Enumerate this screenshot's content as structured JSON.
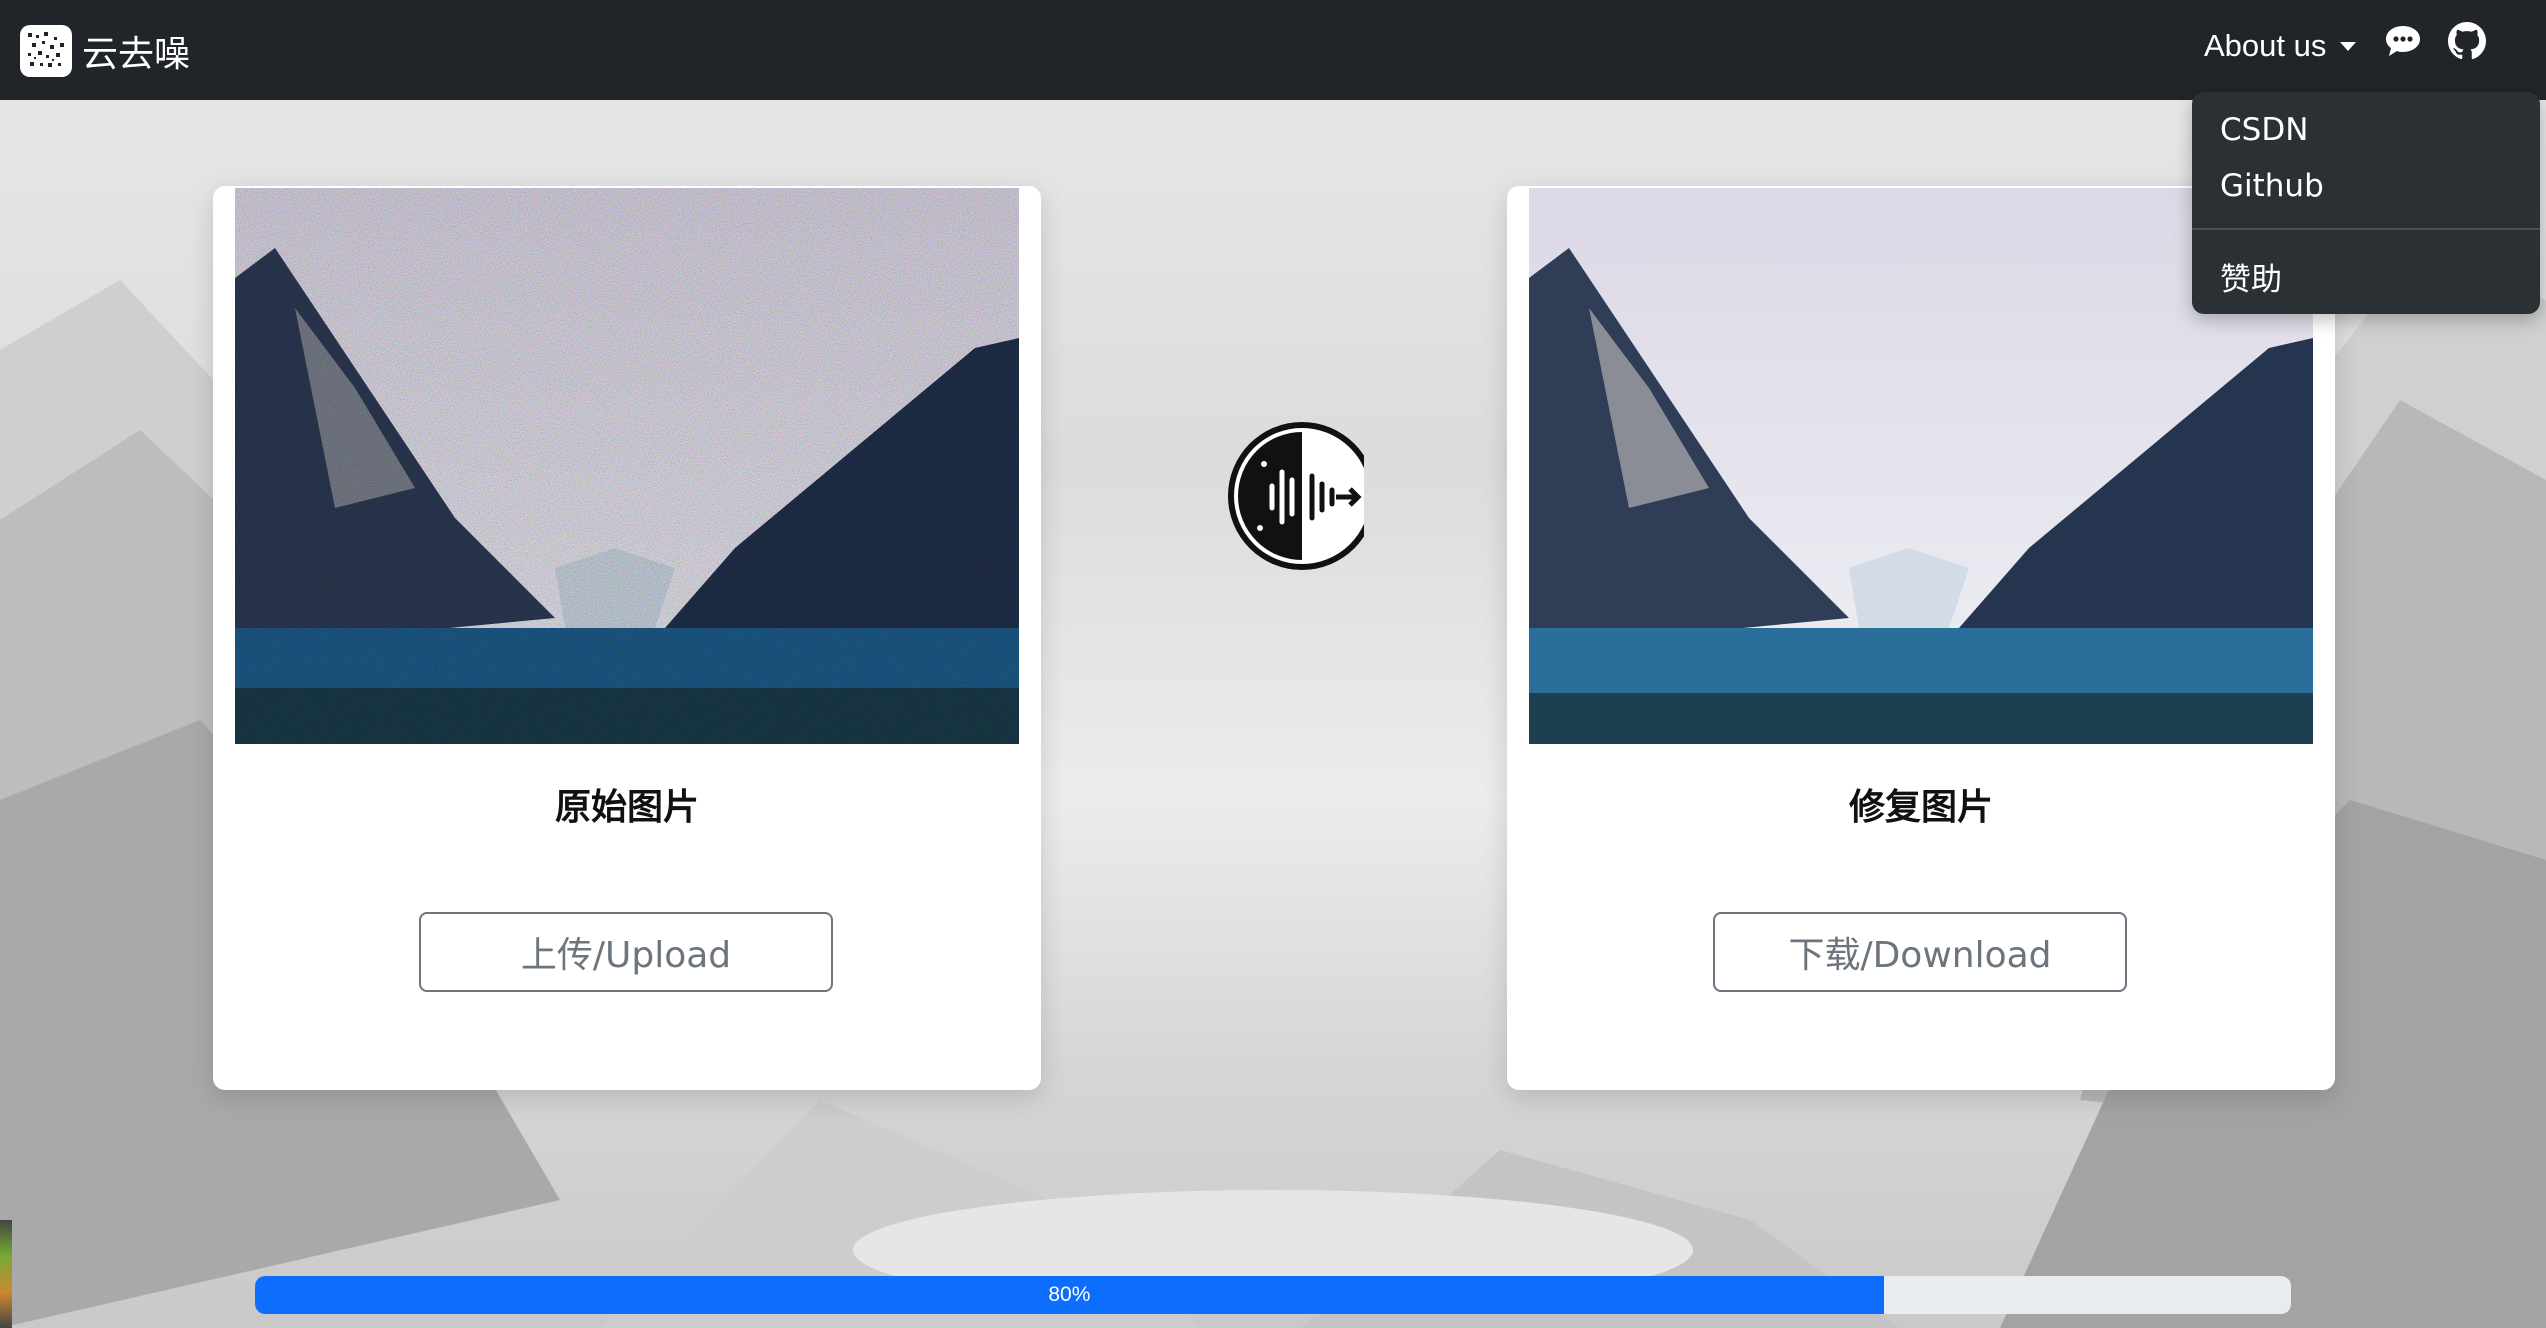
{
  "app": {
    "name": "云去噪"
  },
  "nav": {
    "about_label": "About us"
  },
  "dropdown": {
    "items": [
      "CSDN",
      "Github",
      "赞助"
    ]
  },
  "cards": [
    {
      "title": "原始图片",
      "button": "上传/Upload"
    },
    {
      "title": "修复图片",
      "button": "下载/Download"
    }
  ],
  "progress": {
    "value": 0.8,
    "label": "80%"
  },
  "icons": {
    "brand": "noise-logo-icon",
    "chat": "chat-bubble-icon",
    "github": "github-icon",
    "center": "denoise-logo-icon"
  },
  "colors": {
    "navbar": "#212529",
    "dropdown": "#2b3035",
    "progress_fill": "#0d6efd",
    "progress_track": "#e9ecef",
    "button_border": "#6c757d"
  }
}
